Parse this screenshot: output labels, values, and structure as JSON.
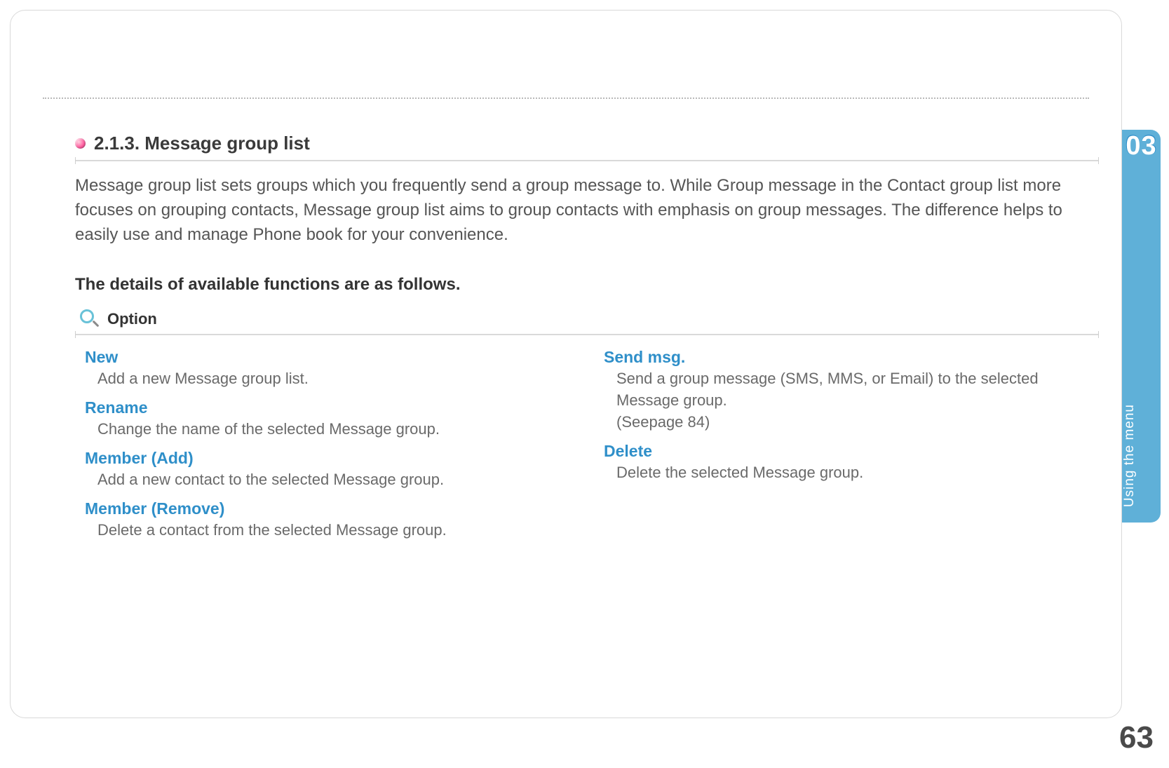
{
  "heading": {
    "number_title": "2.1.3. Message group list"
  },
  "intro": "Message group list sets groups which you frequently send a group message to. While Group message in the Contact group list more focuses on grouping contacts, Message group list aims to group contacts with emphasis on group messages. The difference helps to easily use and manage Phone book for your convenience.",
  "subhead": "The details of available functions are as follows.",
  "option_label": "Option",
  "options_left": [
    {
      "title": "New",
      "desc": "Add a new Message group list."
    },
    {
      "title": "Rename",
      "desc": "Change the name of the selected Message group."
    },
    {
      "title": "Member (Add)",
      "desc": "Add a new contact to the selected Message group."
    },
    {
      "title": "Member (Remove)",
      "desc": "Delete a contact from the selected Message group."
    }
  ],
  "options_right": [
    {
      "title": "Send msg.",
      "desc": "Send a group message (SMS, MMS, or Email) to the selected Message group.\n(Seepage 84)"
    },
    {
      "title": "Delete",
      "desc": "Delete the selected Message group."
    }
  ],
  "side_tab": {
    "chapter": "03",
    "label": "Using the menu"
  },
  "page_number": "63"
}
